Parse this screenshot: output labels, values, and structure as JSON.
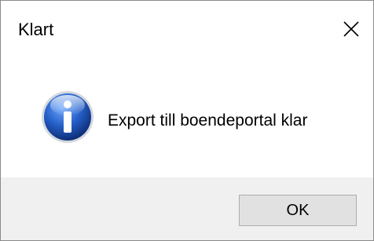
{
  "window": {
    "title": "Klart",
    "close_icon": "close-icon"
  },
  "message": {
    "icon": "information-icon",
    "text": "Export till boendeportal klar"
  },
  "footer": {
    "ok_label": "OK"
  },
  "colors": {
    "footer_background": "#f0f0f0",
    "button_background": "#e1e1e1",
    "button_border": "#adadad",
    "icon_blue": "#1f5fbf"
  }
}
